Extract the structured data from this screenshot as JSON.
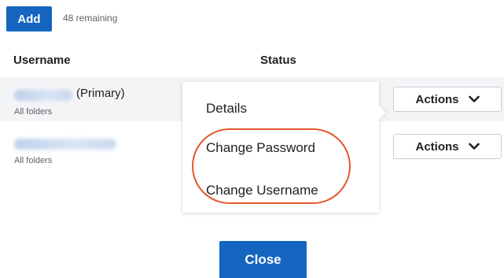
{
  "toolbar": {
    "add_label": "Add",
    "remaining_text": "48 remaining"
  },
  "table": {
    "headers": {
      "username": "Username",
      "status": "Status"
    },
    "rows": [
      {
        "tag": "(Primary)",
        "folders": "All folders",
        "actions_label": "Actions"
      },
      {
        "tag": "",
        "folders": "All folders",
        "actions_label": "Actions"
      }
    ]
  },
  "actions_menu": {
    "items": [
      {
        "label": "Details"
      },
      {
        "label": "Change Password"
      },
      {
        "label": "Change Username"
      }
    ]
  },
  "footer": {
    "close_label": "Close"
  },
  "colors": {
    "primary": "#1565c0",
    "highlight": "#e4572e",
    "row_alt": "#f3f4f6"
  },
  "icons": {
    "actions_chevron": "chevron-down-icon"
  }
}
